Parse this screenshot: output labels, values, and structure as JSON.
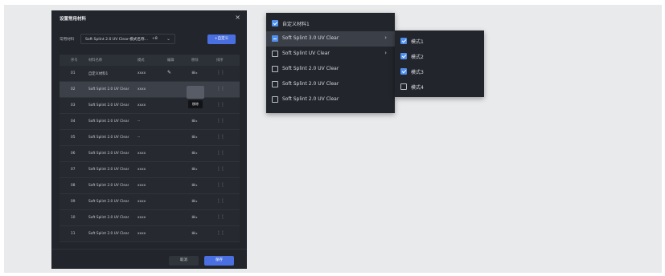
{
  "modal": {
    "title": "设置常用材料",
    "close": "×",
    "toolbar_label": "常用材料",
    "select_value": "Soft Splint 2.0 UV Clear-模式名称...",
    "select_count": "+8",
    "custom_button": "+自定义",
    "columns": [
      "序号",
      "材料名称",
      "模式",
      "编辑",
      "移除",
      "排序"
    ],
    "rows": [
      {
        "idx": "01",
        "name": "自定义材料1",
        "mode": "xxxx"
      },
      {
        "idx": "02",
        "name": "Soft Splint 2.0 UV Clear",
        "mode": "xxxx"
      },
      {
        "idx": "03",
        "name": "Soft Splint 2.0 UV Clear",
        "mode": "xxxx"
      },
      {
        "idx": "04",
        "name": "Soft Splint 2.0 UV Clear",
        "mode": "--"
      },
      {
        "idx": "05",
        "name": "Soft Splint 2.0 UV Clear",
        "mode": "--"
      },
      {
        "idx": "06",
        "name": "Soft Splint 2.0 UV Clear",
        "mode": "xxxx"
      },
      {
        "idx": "07",
        "name": "Soft Splint 2.0 UV Clear",
        "mode": "xxxx"
      },
      {
        "idx": "08",
        "name": "Soft Splint 2.0 UV Clear",
        "mode": "xxxx"
      },
      {
        "idx": "09",
        "name": "Soft Splint 2.0 UV Clear",
        "mode": "xxxx"
      },
      {
        "idx": "10",
        "name": "Soft Splint 2.0 UV Clear",
        "mode": "xxxx"
      },
      {
        "idx": "11",
        "name": "Soft Splint 2.0 UV Clear",
        "mode": "xxxx"
      }
    ],
    "tooltip": "移除",
    "cancel": "取消",
    "save": "保存"
  },
  "menu1": {
    "items": [
      {
        "label": "自定义材料1",
        "state": "checked",
        "arrow": ""
      },
      {
        "label": "Soft Splint 3.0 UV Clear",
        "state": "indeterminate",
        "arrow": "›"
      },
      {
        "label": "Soft Splint UV Clear",
        "state": "unchecked",
        "arrow": "›"
      },
      {
        "label": "Soft Splint 2.0 UV Clear",
        "state": "unchecked",
        "arrow": ""
      },
      {
        "label": "Soft Splint 2.0 UV Clear",
        "state": "unchecked",
        "arrow": ""
      },
      {
        "label": "Soft Splint 2.0 UV Clear",
        "state": "unchecked",
        "arrow": ""
      }
    ]
  },
  "menu2": {
    "items": [
      {
        "label": "模式1",
        "state": "checked"
      },
      {
        "label": "模式2",
        "state": "checked"
      },
      {
        "label": "模式3",
        "state": "checked"
      },
      {
        "label": "模式4",
        "state": "unchecked"
      }
    ]
  },
  "colors": {
    "accent": "#4a6fe0",
    "checkbox": "#4f8ff0",
    "panel": "#22252b"
  }
}
